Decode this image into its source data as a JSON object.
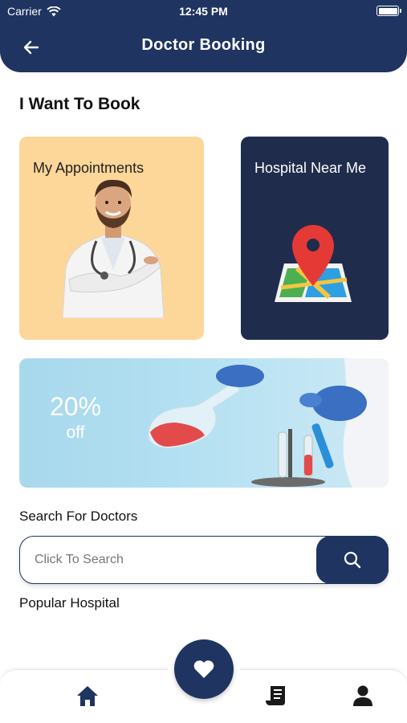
{
  "status_bar": {
    "carrier": "Carrier",
    "time": "12:45 PM"
  },
  "header": {
    "title": "Doctor Booking"
  },
  "booking": {
    "heading": "I Want To Book",
    "cards": [
      {
        "label": "My Appointments"
      },
      {
        "label": "Hospital Near Me"
      }
    ]
  },
  "offer": {
    "percent": "20%",
    "label": "off"
  },
  "search": {
    "heading": "Search For Doctors",
    "placeholder": "Click To Search"
  },
  "popular": {
    "heading": "Popular Hospital"
  },
  "nav": {
    "items": [
      "home-icon",
      "heart-icon",
      "records-icon",
      "profile-icon"
    ]
  },
  "colors": {
    "primary": "#1f3460",
    "appointments_card": "#fdd69a",
    "hospital_card": "#1f2c4c",
    "banner": "#b3e0f2"
  }
}
